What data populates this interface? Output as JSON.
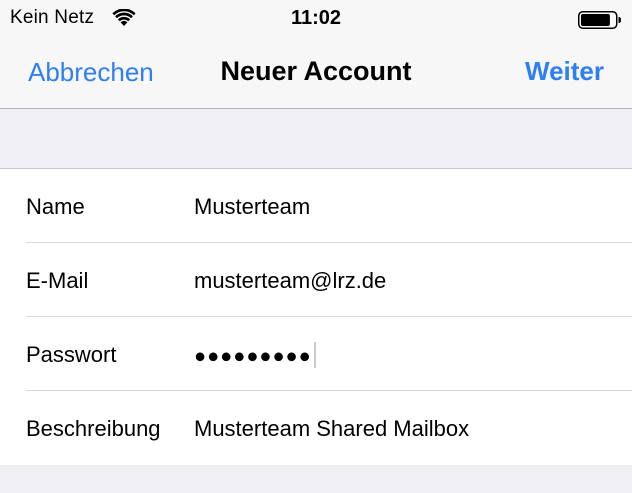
{
  "status_bar": {
    "carrier": "Kein Netz",
    "time": "11:02",
    "wifi_icon": "wifi-icon",
    "battery_icon": "battery-icon",
    "battery_level": 0.85
  },
  "nav": {
    "cancel_label": "Abbrechen",
    "title": "Neuer Account",
    "next_label": "Weiter"
  },
  "form": {
    "rows": [
      {
        "label": "Name",
        "value": "Musterteam"
      },
      {
        "label": "E-Mail",
        "value": "musterteam@lrz.de"
      },
      {
        "label": "Passwort",
        "value": "●●●●●●●●●"
      },
      {
        "label": "Beschreibung",
        "value": "Musterteam Shared Mailbox"
      }
    ]
  },
  "colors": {
    "accent": "#2f7ff2",
    "background": "#efeff4",
    "bar": "#f7f7f7"
  }
}
